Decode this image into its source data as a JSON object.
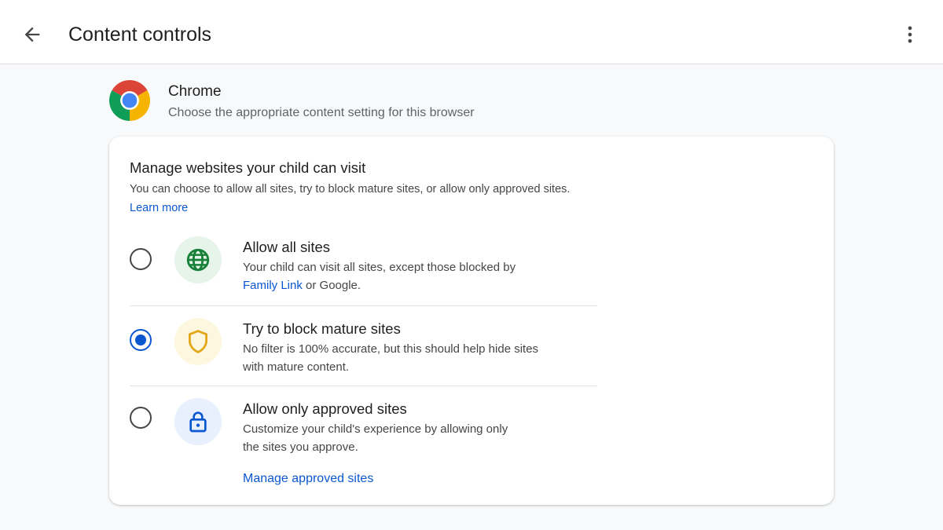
{
  "header": {
    "title": "Content controls",
    "back_icon": "arrow-back-icon",
    "more_icon": "more-vert-icon"
  },
  "app": {
    "name": "Chrome",
    "description": "Choose the appropriate content setting for this browser",
    "logo_icon": "chrome-logo-icon"
  },
  "card": {
    "heading": "Manage websites your child can visit",
    "description": "You can choose to allow all sites, try to block mature sites, or allow only approved sites.",
    "learn_more": "Learn more"
  },
  "options": [
    {
      "title": "Allow all sites",
      "desc_before_link": "Your child can visit all sites, except those blocked by",
      "link": "Family Link",
      "desc_after_link": " or Google.",
      "icon": "globe-icon",
      "selected": false,
      "icon_bg": "#e6f4ea",
      "icon_color": "#188038"
    },
    {
      "title": "Try to block mature sites",
      "description": "No filter is 100% accurate, but this should help hide sites with mature content.",
      "icon": "shield-icon",
      "selected": true,
      "icon_bg": "#fef7e0",
      "icon_color": "#e3a71a"
    },
    {
      "title": "Allow only approved sites",
      "description": "Customize your child's experience by allowing only the sites you approve.",
      "icon": "lock-icon",
      "selected": false,
      "icon_bg": "#e8f0fe",
      "icon_color": "#0b57d0",
      "action_link": "Manage approved sites"
    }
  ],
  "colors": {
    "accent": "#0b57d0",
    "background": "#f8f9fa"
  }
}
